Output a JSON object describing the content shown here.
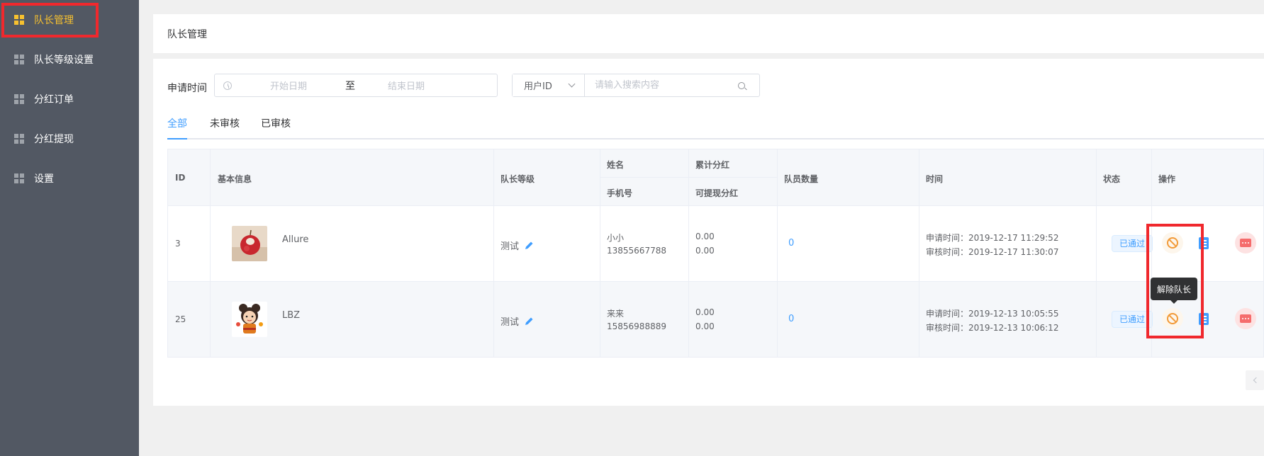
{
  "sidebar": {
    "items": [
      {
        "label": "队长管理",
        "active": true
      },
      {
        "label": "队长等级设置",
        "active": false
      },
      {
        "label": "分红订单",
        "active": false
      },
      {
        "label": "分红提现",
        "active": false
      },
      {
        "label": "设置",
        "active": false
      }
    ]
  },
  "page": {
    "title": "队长管理"
  },
  "filters": {
    "date_label": "申请时间",
    "start_placeholder": "开始日期",
    "range_separator": "至",
    "end_placeholder": "结束日期",
    "search_field": "用户ID",
    "search_placeholder": "请输入搜索内容"
  },
  "tabs": [
    {
      "label": "全部",
      "active": true
    },
    {
      "label": "未审核",
      "active": false
    },
    {
      "label": "已审核",
      "active": false
    }
  ],
  "table": {
    "headers": {
      "id": "ID",
      "basic_info": "基本信息",
      "level": "队长等级",
      "name": "姓名",
      "phone": "手机号",
      "total_dividend": "累计分红",
      "withdrawable_dividend": "可提现分红",
      "member_count": "队员数量",
      "time": "时间",
      "status": "状态",
      "actions": "操作"
    },
    "rows": [
      {
        "id": "3",
        "nickname": "Allure",
        "level": "测试",
        "name": "小小",
        "phone": "13855667788",
        "total_dividend": "0.00",
        "withdrawable_dividend": "0.00",
        "member_count": "0",
        "apply_time": "申请时间：2019-12-17 11:29:52",
        "review_time": "审核时间：2019-12-17 11:30:07",
        "status": "已通过"
      },
      {
        "id": "25",
        "nickname": "LBZ",
        "level": "测试",
        "name": "来来",
        "phone": "15856988889",
        "total_dividend": "0.00",
        "withdrawable_dividend": "0.00",
        "member_count": "0",
        "apply_time": "申请时间：2019-12-13 10:05:55",
        "review_time": "审核时间：2019-12-13 10:06:12",
        "status": "已通过"
      }
    ]
  },
  "tooltip": {
    "text": "解除队长"
  },
  "colors": {
    "sidebar_bg": "#525863",
    "active_menu": "#f7c12f",
    "primary": "#409eff",
    "warning": "#f29a38",
    "danger": "#f56c6c",
    "highlight_box": "#f0282d"
  }
}
